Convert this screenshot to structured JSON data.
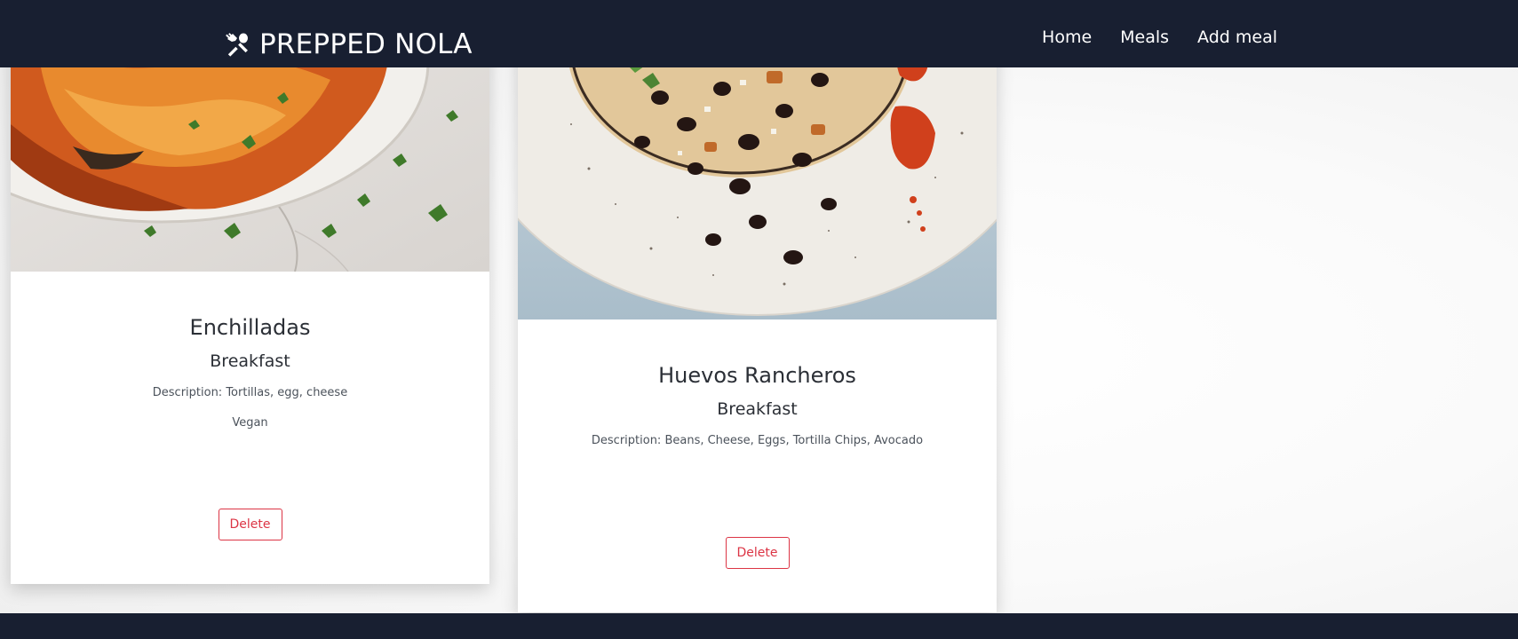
{
  "navbar": {
    "brand": "PREPPED NOLA",
    "links": [
      "Home",
      "Meals",
      "Add meal"
    ]
  },
  "meals": [
    {
      "name": "Enchilladas",
      "category": "Breakfast",
      "description": "Description: Tortillas, egg, cheese",
      "tag": "Vegan",
      "delete_label": "Delete"
    },
    {
      "name": "Huevos Rancheros",
      "category": "Breakfast",
      "description": "Description: Beans, Cheese, Eggs, Tortilla Chips, Avocado",
      "delete_label": "Delete"
    }
  ],
  "colors": {
    "navbar": "#181f31",
    "danger": "#dc3545"
  }
}
